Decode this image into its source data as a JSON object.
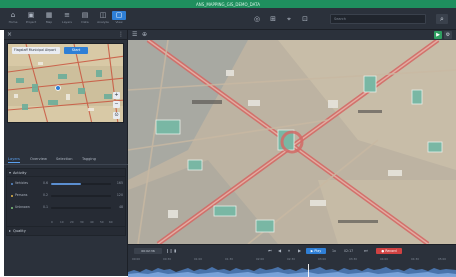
{
  "window": {
    "title": "ANS_MAPPING_GIS_DEMO_DATA"
  },
  "toolbar": {
    "buttons": [
      {
        "label": "Home",
        "icon": "home-icon",
        "glyph": "⌂"
      },
      {
        "label": "Project",
        "icon": "folder-icon",
        "glyph": "▣"
      },
      {
        "label": "Map",
        "icon": "map-icon",
        "glyph": "▦"
      },
      {
        "label": "Layers",
        "icon": "layers-icon",
        "glyph": "≡"
      },
      {
        "label": "Data",
        "icon": "table-icon",
        "glyph": "▤"
      },
      {
        "label": "Analyze",
        "icon": "chart-icon",
        "glyph": "◫"
      },
      {
        "label": "View",
        "icon": "view-icon",
        "glyph": "▢"
      }
    ],
    "center_icons": [
      "◎",
      "⊞",
      "⌖",
      "⊡"
    ],
    "search_placeholder": "Search",
    "search_glyph": "⌕"
  },
  "left_panel": {
    "minimap": {
      "address": "Flagstaff Municipal Airport",
      "button": "Start",
      "controls": [
        "+",
        "−",
        "⊙"
      ]
    },
    "tabs": [
      "Layers",
      "Overview",
      "Selection",
      "Tagging"
    ],
    "activity": {
      "title": "Activity",
      "rows": [
        {
          "name": "Vehicles",
          "value": "0.6",
          "count": "165",
          "fill": 0.5,
          "color": "#5b8fd1"
        },
        {
          "name": "Persons",
          "value": "0.2",
          "count": "120",
          "fill": 0.0,
          "color": "#e6b74a"
        },
        {
          "name": "Unknown",
          "value": "0.1",
          "count": "48",
          "fill": 0.0,
          "color": "#7ec67a"
        }
      ],
      "axis": [
        "0",
        "10",
        "20",
        "30",
        "40",
        "50",
        "60"
      ]
    },
    "quality": {
      "title": "Quality"
    }
  },
  "viewer": {
    "icons": [
      "☰",
      "⊕"
    ],
    "right_icons": [
      "▶",
      "⚙"
    ]
  },
  "timeline": {
    "time": "00:02:36",
    "controls": [
      "❙❙",
      "▮",
      "⏮",
      "◀",
      "⏸",
      "▶",
      "⏭"
    ],
    "play_label": "▶ Play",
    "speed": "1x",
    "frame": "02:17",
    "record_label": "● Record",
    "ticks": [
      "00:00",
      "00:30",
      "01:00",
      "01:30",
      "02:00",
      "02:30",
      "03:00",
      "03:30",
      "04:00",
      "04:30",
      "05:00"
    ]
  },
  "colors": {
    "title_bar": "#1f8f5e",
    "panel": "#2b313b",
    "accent": "#2f7fd6",
    "record": "#d04242",
    "road": "#d66b6b"
  }
}
